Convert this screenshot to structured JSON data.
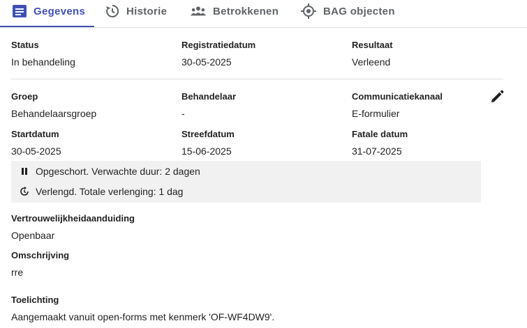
{
  "tabs": [
    {
      "label": "Gegevens",
      "icon": "document-list-icon",
      "active": true
    },
    {
      "label": "Historie",
      "icon": "history-icon",
      "active": false
    },
    {
      "label": "Betrokkenen",
      "icon": "group-icon",
      "active": false
    },
    {
      "label": "BAG objecten",
      "icon": "target-icon",
      "active": false
    }
  ],
  "colors": {
    "accent": "#3f51b5",
    "status_bg": "#f1f1f1"
  },
  "fields": {
    "status": {
      "label": "Status",
      "value": "In behandeling"
    },
    "registratiedatum": {
      "label": "Registratiedatum",
      "value": "30-05-2025"
    },
    "resultaat": {
      "label": "Resultaat",
      "value": "Verleend"
    },
    "groep": {
      "label": "Groep",
      "value": "Behandelaarsgroep"
    },
    "behandelaar": {
      "label": "Behandelaar",
      "value": "-"
    },
    "communicatiekanaal": {
      "label": "Communicatiekanaal",
      "value": "E-formulier"
    },
    "startdatum": {
      "label": "Startdatum",
      "value": "30-05-2025"
    },
    "streefdatum": {
      "label": "Streefdatum",
      "value": "15-06-2025"
    },
    "fatale_datum": {
      "label": "Fatale datum",
      "value": "31-07-2025"
    },
    "vertrouwelijkheid": {
      "label": "Vertrouwelijkheidaanduiding",
      "value": "Openbaar"
    },
    "omschrijving": {
      "label": "Omschrijving",
      "value": "rre"
    },
    "toelichting": {
      "label": "Toelichting",
      "value": "Aangemaakt vanuit open-forms met kenmerk 'OF-WF4DW9'."
    }
  },
  "status_notes": {
    "suspended": {
      "text": "Opgeschort. Verwachte duur: 2 dagen",
      "icon": "pause-icon"
    },
    "extended": {
      "text": "Verlengd. Totale verlenging: 1 dag",
      "icon": "extend-clock-icon"
    }
  }
}
